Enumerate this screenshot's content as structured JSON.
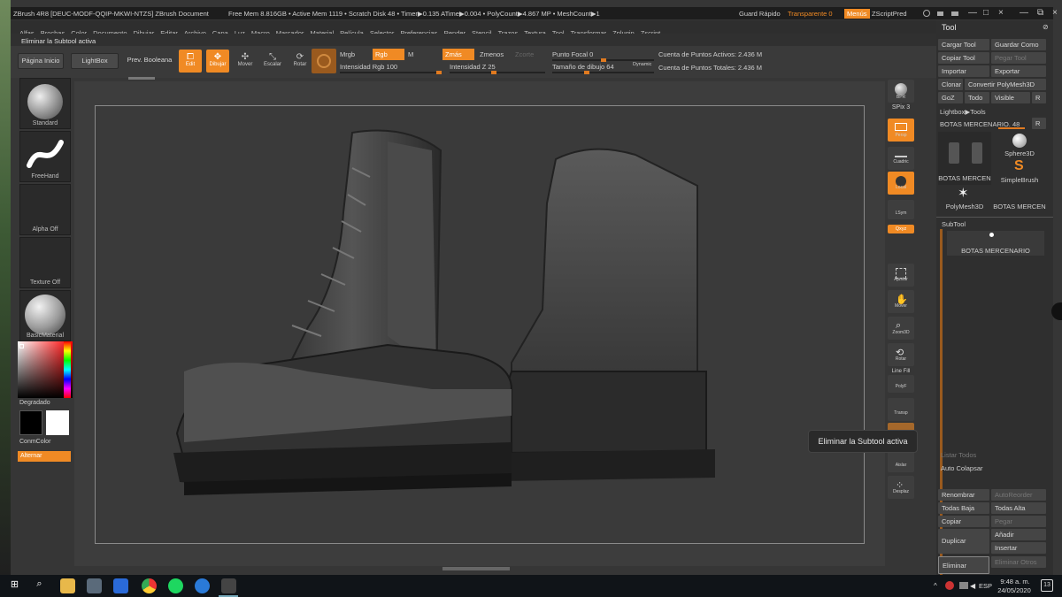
{
  "titlebar": {
    "doc": "ZBrush 4R8 [DEUC-MODF-QQIP-MKWI-NTZS]   ZBrush Document",
    "stats": "Free Mem 8.816GB • Active Mem 1119 • Scratch Disk 48 • Timer▶0.135 ATime▶0.004 • PolyCount▶4.867 MP • MeshCount▶1",
    "quicksave": "Guard Rápido",
    "transparency": "Transparente 0",
    "menus": "Menús",
    "script": "ZScriptPred"
  },
  "menubar": [
    "Alfas",
    "Brochas",
    "Color",
    "Documento",
    "Dibujar",
    "Editar",
    "Archivo",
    "Capa",
    "Luz",
    "Macro",
    "Marcador",
    "Material",
    "Película",
    "Selector",
    "Preferencias",
    "Render",
    "Stencil",
    "Trazos",
    "Textura",
    "Tool",
    "Transformar",
    "Zplugin",
    "Zscript"
  ],
  "status": "Eliminar la Subtool activa",
  "shelf": {
    "home": "Página Inicio",
    "lightbox": "LightBox",
    "boolean": "Prev. Booleana",
    "edit": "Edit",
    "draw": "Dibujar",
    "move": "Mover",
    "scale": "Escalar",
    "rotate": "Rotar",
    "mrgb": "Mrgb",
    "rgb": "Rgb",
    "m": "M",
    "rgb_intensity": "Intensidad Rgb 100",
    "zadd": "Zmás",
    "zsub": "Zmenos",
    "zcut": "Zcorte",
    "z_intensity": "Intensidad Z 25",
    "focal": "Punto Focal 0",
    "draw_size": "Tamaño de dibujo 64",
    "dynamic": "Dynamic",
    "active_points": "Cuenta de Puntos Activos: 2.436 M",
    "total_points": "Cuenta de Puntos Totales: 2.436 M"
  },
  "left": {
    "brush": "Standard",
    "stroke": "FreeHand",
    "alpha": "Alpha Off",
    "texture": "Texture Off",
    "material": "BasicMaterial",
    "gradient": "Degradado",
    "switch_color": "ConmColor",
    "alternate": "Alternar"
  },
  "right_tools": {
    "bpr": "BPR",
    "spix": "SPix 3",
    "persp": "Persp",
    "floor": "Cuadric",
    "local": "Local",
    "lsym": "LSym",
    "xyz": "Qxyz",
    "frame": "Ajustar",
    "move": "Mover",
    "zoom": "Zoom3D",
    "rotate": "Rotar",
    "linefill": "Line Fill",
    "polyf": "PolyF",
    "transp": "Transp",
    "solo": "Aislar",
    "xpose": "Desplaz"
  },
  "tool": {
    "title": "Tool",
    "load": "Cargar Tool",
    "save_as": "Guardar Como",
    "copy": "Copiar Tool",
    "paste": "Pegar Tool",
    "import": "Importar",
    "export": "Exportar",
    "clone": "Clonar",
    "polymesh": "Convertir PolyMesh3D",
    "goz": "GoZ",
    "all": "Todo",
    "visible": "Visible",
    "r": "R",
    "lightbox_tools": "Lightbox▶Tools",
    "current": "BOTAS MERCENARIO. 48",
    "thumbs": [
      "BOTAS MERCEN",
      "Sphere3D",
      "SimpleBrush",
      "PolyMesh3D",
      "BOTAS MERCEN"
    ],
    "subtool_title": "SubTool",
    "subtool_item": "BOTAS MERCENARIO",
    "list_all": "Listar Todos",
    "auto_collapse": "Auto Colapsar",
    "rename": "Renombrar",
    "autoreorder": "AutoReorder",
    "all_low": "Todas Baja",
    "all_high": "Todas Alta",
    "copy_sub": "Copiar",
    "paste_sub": "Pegar",
    "duplicate": "Duplicar",
    "append": "Añadir",
    "insert": "Insertar",
    "delete": "Eliminar",
    "delete_other": "Eliminar Otros"
  },
  "tooltip": "Eliminar la Subtool activa",
  "taskbar": {
    "time": "9:48 a. m.",
    "date": "24/05/2020",
    "lang": "ESP",
    "notif": "13"
  }
}
